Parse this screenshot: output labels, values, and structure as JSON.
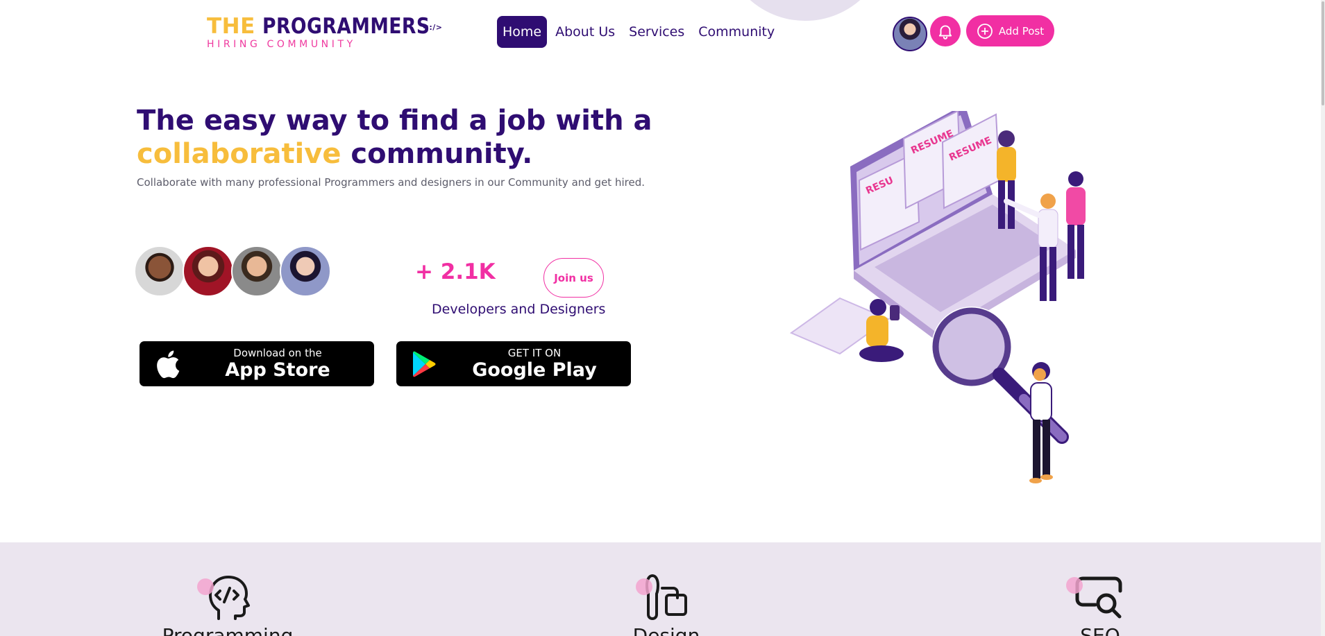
{
  "header": {
    "logo": {
      "word1": "THE",
      "word2": "PROGRAMMERS",
      "tagline": "HIRING COMMUNITY",
      "code_glyph": "<:/>"
    },
    "nav": [
      {
        "label": "Home",
        "active": true
      },
      {
        "label": "About Us",
        "active": false
      },
      {
        "label": "Services",
        "active": false
      },
      {
        "label": "Community",
        "active": false
      }
    ],
    "add_post_label": "Add Post",
    "icons": {
      "bell": "bell-icon",
      "plus": "plus-circle-icon"
    }
  },
  "hero": {
    "title_part1": "The easy way to find a job with a",
    "title_accent": "collaborative",
    "title_part2": "community.",
    "subtitle": "Collaborate with many professional Programmers and designers in our Community and get hired.",
    "member_count": "+ 2.1K",
    "member_label": "Developers and Designers",
    "join_label": "Join us"
  },
  "stores": {
    "apple": {
      "small": "Download on the",
      "big": "App Store"
    },
    "google": {
      "small": "GET IT ON",
      "big": "Google Play"
    }
  },
  "illustration": {
    "resume_labels": [
      "RESU",
      "RESUME",
      "RESUME"
    ]
  },
  "services": [
    {
      "label": "Programming",
      "icon": "head-code-icon"
    },
    {
      "label": "Design",
      "icon": "brush-shapes-icon"
    },
    {
      "label": "SEO",
      "icon": "search-bubble-icon"
    }
  ],
  "colors": {
    "primary": "#2f0d72",
    "accent_yellow": "#f7bd3c",
    "accent_pink": "#f12fa3",
    "band": "#ebe5ef"
  }
}
